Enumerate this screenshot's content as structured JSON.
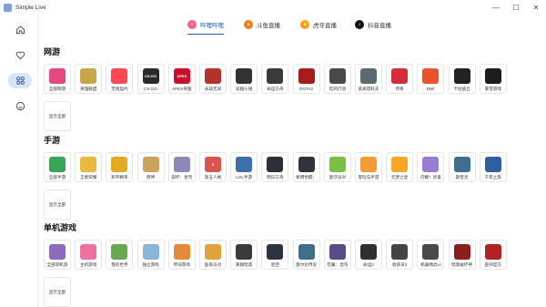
{
  "window": {
    "title": "Simple Live",
    "controls": [
      "—",
      "☐",
      "✕"
    ]
  },
  "sidebar": {
    "items": [
      {
        "name": "home",
        "icon": "home-icon"
      },
      {
        "name": "favorites",
        "icon": "heart-icon"
      },
      {
        "name": "categories",
        "icon": "category-grid-icon",
        "active": true
      },
      {
        "name": "mine",
        "icon": "smile-icon"
      }
    ]
  },
  "tabs": [
    {
      "label": "哔哩哔哩",
      "icon": "bilibili-icon",
      "color": "#f06292",
      "active": true
    },
    {
      "label": "斗鱼直播",
      "icon": "douyu-icon",
      "color": "#ff7a1a",
      "active": false
    },
    {
      "label": "虎牙直播",
      "icon": "huya-icon",
      "color": "#ff9f1c",
      "active": false
    },
    {
      "label": "抖音直播",
      "icon": "douyin-icon",
      "color": "#111111",
      "active": false
    }
  ],
  "sections": [
    {
      "title": "网游",
      "items": [
        {
          "label": "全部网游",
          "color": "#e64980",
          "mark": ""
        },
        {
          "label": "英雄联盟",
          "color": "#c8a74a",
          "mark": ""
        },
        {
          "label": "无畏契约",
          "color": "#ff4655",
          "mark": ""
        },
        {
          "label": "CS:GO",
          "color": "#2b2b2b",
          "mark": "CS:GO"
        },
        {
          "label": "APEX英雄",
          "color": "#c8102e",
          "mark": "APEX"
        },
        {
          "label": "永劫无间",
          "color": "#b5312c",
          "mark": ""
        },
        {
          "label": "穿越火线",
          "color": "#333333",
          "mark": ""
        },
        {
          "label": "命运方舟",
          "color": "#3a3a3a",
          "mark": ""
        },
        {
          "label": "DOTA2",
          "color": "#a61b1b",
          "mark": ""
        },
        {
          "label": "吃鸡行动",
          "color": "#4a4a4a",
          "mark": ""
        },
        {
          "label": "逃离塔科夫",
          "color": "#5a6a70",
          "mark": ""
        },
        {
          "label": "传奇",
          "color": "#d62d3a",
          "mark": ""
        },
        {
          "label": "DNF",
          "color": "#e8532b",
          "mark": ""
        },
        {
          "label": "卡拉彼丘",
          "color": "#222222",
          "mark": ""
        },
        {
          "label": "暴雪游戏",
          "color": "#1c1c1c",
          "mark": ""
        },
        {
          "label": "显示全部",
          "show_all": true
        }
      ]
    },
    {
      "title": "手游",
      "items": [
        {
          "label": "全部手游",
          "color": "#3aa655",
          "mark": ""
        },
        {
          "label": "王者荣耀",
          "color": "#e8b93f",
          "mark": ""
        },
        {
          "label": "和平精英",
          "color": "#e5a823",
          "mark": ""
        },
        {
          "label": "原神",
          "color": "#c9a45c",
          "mark": ""
        },
        {
          "label": "崩坏：星穹",
          "color": "#8c8ab8",
          "mark": ""
        },
        {
          "label": "第五人格",
          "color": "#d9534f",
          "mark": "5"
        },
        {
          "label": "LOL手游",
          "color": "#3d6fa8",
          "mark": ""
        },
        {
          "label": "明日方舟",
          "color": "#2a2f3a",
          "mark": ""
        },
        {
          "label": "黎明觉醒：",
          "color": "#30353d",
          "mark": ""
        },
        {
          "label": "蛋仔派对",
          "color": "#7bc043",
          "mark": ""
        },
        {
          "label": "冒险岛手游",
          "color": "#f29c38",
          "mark": ""
        },
        {
          "label": "元梦之星",
          "color": "#f5a623",
          "mark": ""
        },
        {
          "label": "闪耀！优俊",
          "color": "#9b7bd4",
          "mark": ""
        },
        {
          "label": "斯普灵",
          "color": "#3f6f8f",
          "mark": ""
        },
        {
          "label": "千年之旅",
          "color": "#2e5fa0",
          "mark": ""
        },
        {
          "label": "显示全部",
          "show_all": true
        }
      ]
    },
    {
      "title": "单机游戏",
      "items": [
        {
          "label": "全部单机游",
          "color": "#8e6bbf",
          "mark": ""
        },
        {
          "label": "主机游戏",
          "color": "#ef6fa0",
          "mark": ""
        },
        {
          "label": "我的世界",
          "color": "#6aa84f",
          "mark": ""
        },
        {
          "label": "独立游戏",
          "color": "#8ab4d8",
          "mark": ""
        },
        {
          "label": "怀旧游戏",
          "color": "#e5893a",
          "mark": ""
        },
        {
          "label": "猛兽派对",
          "color": "#e0a23a",
          "mark": ""
        },
        {
          "label": "黄猿暗黑",
          "color": "#3a3a3a",
          "mark": ""
        },
        {
          "label": "星空",
          "color": "#2b3440",
          "mark": ""
        },
        {
          "label": "塞尔达传说",
          "color": "#3d6e8a",
          "mark": ""
        },
        {
          "label": "苍翼：混沌",
          "color": "#5b4a8a",
          "mark": ""
        },
        {
          "label": "命运2",
          "color": "#2f2f2f",
          "mark": ""
        },
        {
          "label": "收获日3",
          "color": "#444444",
          "mark": ""
        },
        {
          "label": "机器佣兵VI",
          "color": "#4a4a4a",
          "mark": ""
        },
        {
          "label": "暗黑破坏神",
          "color": "#8b1e1e",
          "mark": ""
        },
        {
          "label": "巫师官方",
          "color": "#b22222",
          "mark": ""
        },
        {
          "label": "显示全部",
          "show_all": true
        }
      ]
    }
  ]
}
